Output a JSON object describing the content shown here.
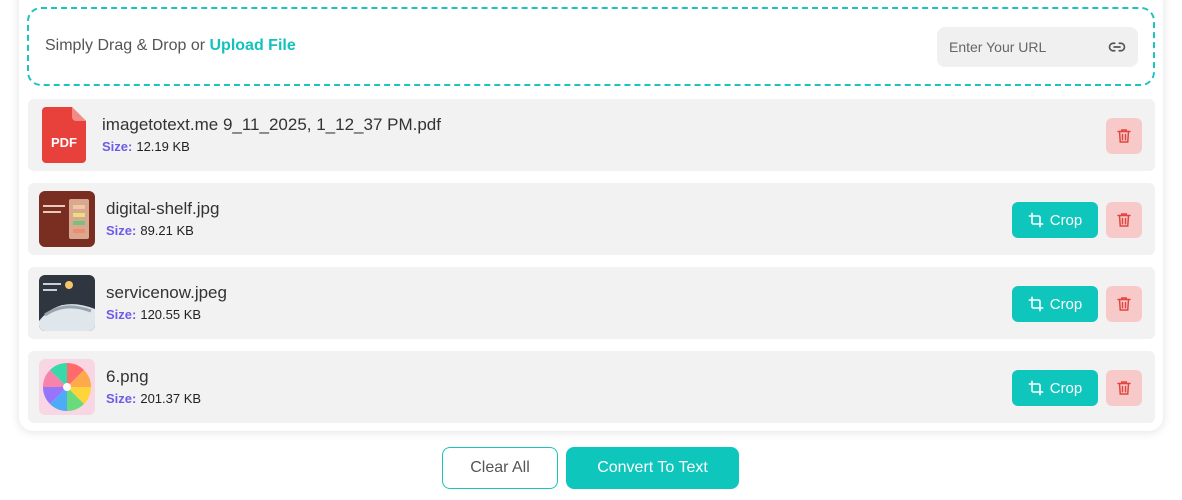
{
  "dropzone": {
    "text": "Simply Drag & Drop or",
    "upload_link": "Upload File",
    "url_placeholder": "Enter Your URL",
    "url_icon": "link-icon"
  },
  "files": [
    {
      "name": "imagetotext.me 9_11_2025, 1_12_37 PM.pdf",
      "size_label": "Size:",
      "size": "12.19 KB",
      "icon": "pdf-icon",
      "pdf_badge": "PDF"
    },
    {
      "name": "digital-shelf.jpg",
      "size_label": "Size:",
      "size": "89.21 KB",
      "crop_label": "Crop"
    },
    {
      "name": "servicenow.jpeg",
      "size_label": "Size:",
      "size": "120.55 KB",
      "crop_label": "Crop"
    },
    {
      "name": "6.png",
      "size_label": "Size:",
      "size": "201.37 KB",
      "crop_label": "Crop"
    }
  ],
  "actions": {
    "clear_label": "Clear All",
    "convert_label": "Convert To Text"
  },
  "colors": {
    "accent": "#0fc6bd",
    "size_label": "#6c5ce7",
    "delete_bg": "#f8c9c9",
    "delete_icon": "#e0463f",
    "pdf_red": "#e8403a"
  }
}
